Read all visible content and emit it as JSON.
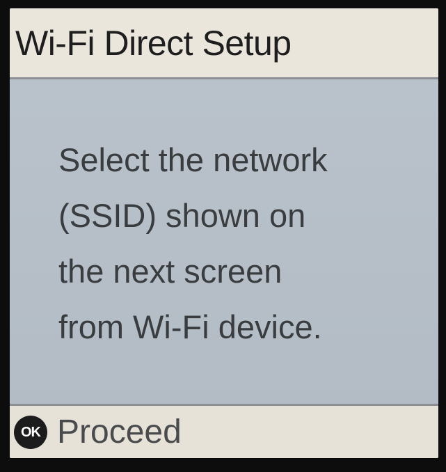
{
  "header": {
    "title": "Wi-Fi Direct Setup"
  },
  "message": {
    "lines": [
      "Select the network",
      "(SSID) shown on",
      "the next screen",
      "from Wi-Fi device."
    ]
  },
  "footer": {
    "ok_icon_label": "OK",
    "proceed_label": "Proceed"
  },
  "colors": {
    "title_bar_bg": "#ebe6dc",
    "message_bg": "#b7c0c8",
    "footer_bg": "#e6e2d8",
    "text": "#3a3d40",
    "bezel": "#0d0d0d"
  },
  "icons": {
    "ok_button": "ok-button-icon"
  }
}
